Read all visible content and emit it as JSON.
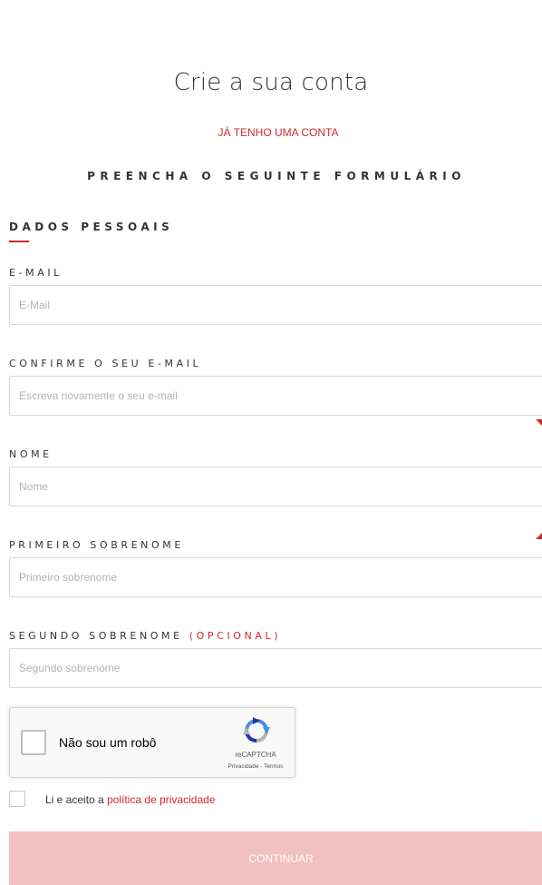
{
  "header": {
    "title": "Crie a sua conta",
    "have_account_link": "JÁ TENHO UMA CONTA",
    "form_heading": "PREENCHA O SEGUINTE FORMULÁRIO"
  },
  "section": {
    "title": "DADOS PESSOAIS"
  },
  "fields": {
    "email": {
      "label": "E-MAIL",
      "placeholder": "E-Mail",
      "value": ""
    },
    "confirm_email": {
      "label": "CONFIRME O SEU E-MAIL",
      "placeholder": "Escreva novamente o seu e-mail",
      "value": ""
    },
    "name": {
      "label": "NOME",
      "placeholder": "Nome",
      "value": ""
    },
    "first_surname": {
      "label": "PRIMEIRO SOBRENOME",
      "placeholder": "Primeiro sobrenome",
      "value": ""
    },
    "second_surname": {
      "label": "SEGUNDO SOBRENOME",
      "optional_label": "(OPCIONAL)",
      "placeholder": "Segundo sobrenome",
      "value": ""
    }
  },
  "recaptcha": {
    "label": "Não sou um robô",
    "brand": "reCAPTCHA",
    "links": "Privacidade - Termos",
    "checked": false
  },
  "privacy": {
    "text": "Li e aceito a",
    "link": "política de privacidade",
    "checked": false
  },
  "submit": {
    "label": "CONTINUAR"
  },
  "colors": {
    "accent": "#d1272e",
    "submit_disabled": "#f2c0bf",
    "input_border": "#d9d9d9"
  }
}
